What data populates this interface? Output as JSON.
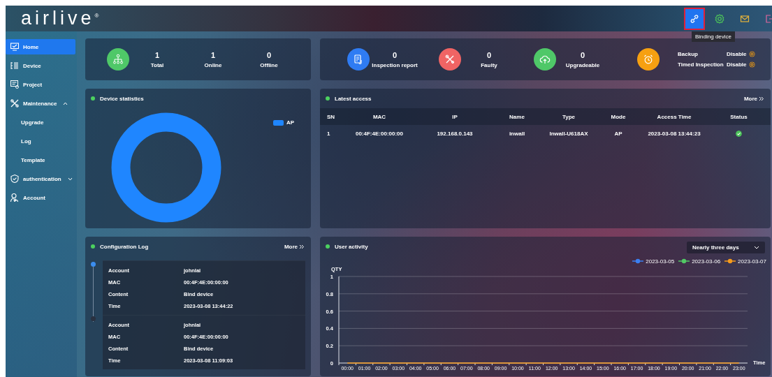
{
  "header": {
    "logo": "airlive$^{®}$",
    "actions": [
      {
        "highlighted": true
      },
      {
        "highlighted": false
      },
      {
        "highlighted": false
      },
      {
        "highlighted": false
      }
    ],
    "tooltip": "Binding device"
  },
  "sidebar": {
    "items": [
      {
        "label": "Home",
        "selected": true
      },
      {
        "label": "Device",
        "selected": false
      },
      {
        "label": "Project",
        "selected": false
      },
      {
        "label": "Maintenance",
        "selected": false,
        "expanded": true,
        "children": [
          {
            "label": "Upgrade",
            "selected": false
          },
          {
            "label": "Log",
            "selected": false
          },
          {
            "label": "Template",
            "selected": false
          }
        ]
      },
      {
        "label": "authentication",
        "selected": false,
        "expanded": false
      },
      {
        "label": "Account",
        "selected": false
      }
    ]
  },
  "device_counts": [
    {
      "value": "1",
      "label": "Total"
    },
    {
      "value": "1",
      "label": "Online"
    },
    {
      "value": "0",
      "label": "Offline"
    }
  ],
  "summary": {
    "items": [
      {
        "value": "0",
        "label": "Inspection report",
        "color": "#2f7cf3"
      },
      {
        "value": "0",
        "label": "Faulty",
        "color": "#f06464"
      },
      {
        "value": "0",
        "label": "Upgradeable",
        "color": "#4fc868"
      }
    ],
    "schedule": [
      {
        "label": "Backup",
        "value": "Disable"
      },
      {
        "label": "Timed Inspection",
        "value": "Disable"
      }
    ]
  },
  "device_statistics": {
    "title": "Device statistics",
    "legend": "AP"
  },
  "latest_access": {
    "title": "Latest access",
    "more": "More",
    "columns": [
      "SN",
      "MAC",
      "IP",
      "Name",
      "Type",
      "Mode",
      "Access Time",
      "Status"
    ],
    "rows": [
      {
        "cells": [
          "1",
          "00:4F:4E:00:00:00",
          "192.168.0.143",
          "inwall",
          "Inwall-U618AX",
          "AP",
          "2023-03-08 13:44:23"
        ],
        "online": true
      }
    ]
  },
  "configuration_log": {
    "title": "Configuration Log",
    "more": "More",
    "entries": [
      {
        "active": true,
        "fields": [
          {
            "label": "Account",
            "value": "johnlai"
          },
          {
            "label": "MAC",
            "value": "00:4F:4E:00:00:00"
          },
          {
            "label": "Content",
            "value": "Bind device"
          },
          {
            "label": "Time",
            "value": "2023-03-08 13:44:22"
          }
        ]
      },
      {
        "active": false,
        "fields": [
          {
            "label": "Account",
            "value": "johnlai"
          },
          {
            "label": "MAC",
            "value": "00:4F:4E:00:00:00"
          },
          {
            "label": "Content",
            "value": "Bind device"
          },
          {
            "label": "Time",
            "value": "2023-03-08 11:09:03"
          }
        ]
      }
    ]
  },
  "user_activity": {
    "title": "User activity",
    "range": "Nearly three days",
    "chart_data": {
      "type": "line",
      "ylabel": "QTY",
      "xlabel": "Time",
      "categories": [
        "00:00",
        "01:00",
        "02:00",
        "03:00",
        "04:00",
        "05:00",
        "06:00",
        "07:00",
        "08:00",
        "09:00",
        "10:00",
        "11:00",
        "12:00",
        "13:00",
        "14:00",
        "15:00",
        "16:00",
        "17:00",
        "18:00",
        "19:00",
        "20:00",
        "21:00",
        "22:00",
        "23:00"
      ],
      "ylim": [
        0,
        1
      ],
      "grid": true,
      "yticks": [
        0,
        0.2,
        0.4,
        0.6,
        0.8,
        1
      ],
      "series": [
        {
          "name": "2023-03-05",
          "color": "#3b7ff0",
          "values": [
            null,
            null,
            null,
            null,
            null,
            null,
            null,
            null,
            null,
            null,
            null,
            null,
            null,
            null,
            null,
            null,
            null,
            null,
            null,
            null,
            null,
            null,
            null,
            null
          ]
        },
        {
          "name": "2023-03-06",
          "color": "#52c865",
          "values": [
            null,
            null,
            null,
            null,
            null,
            null,
            null,
            null,
            null,
            null,
            null,
            null,
            null,
            null,
            null,
            null,
            null,
            null,
            null,
            null,
            null,
            null,
            null,
            null
          ]
        },
        {
          "name": "2023-03-07",
          "color": "#f59a1c",
          "values": [
            0,
            0,
            0,
            0,
            0,
            0,
            0,
            0,
            0,
            0,
            0,
            0,
            0,
            0,
            0,
            0,
            0,
            0,
            0,
            0,
            0,
            0,
            0,
            0
          ]
        }
      ]
    }
  }
}
